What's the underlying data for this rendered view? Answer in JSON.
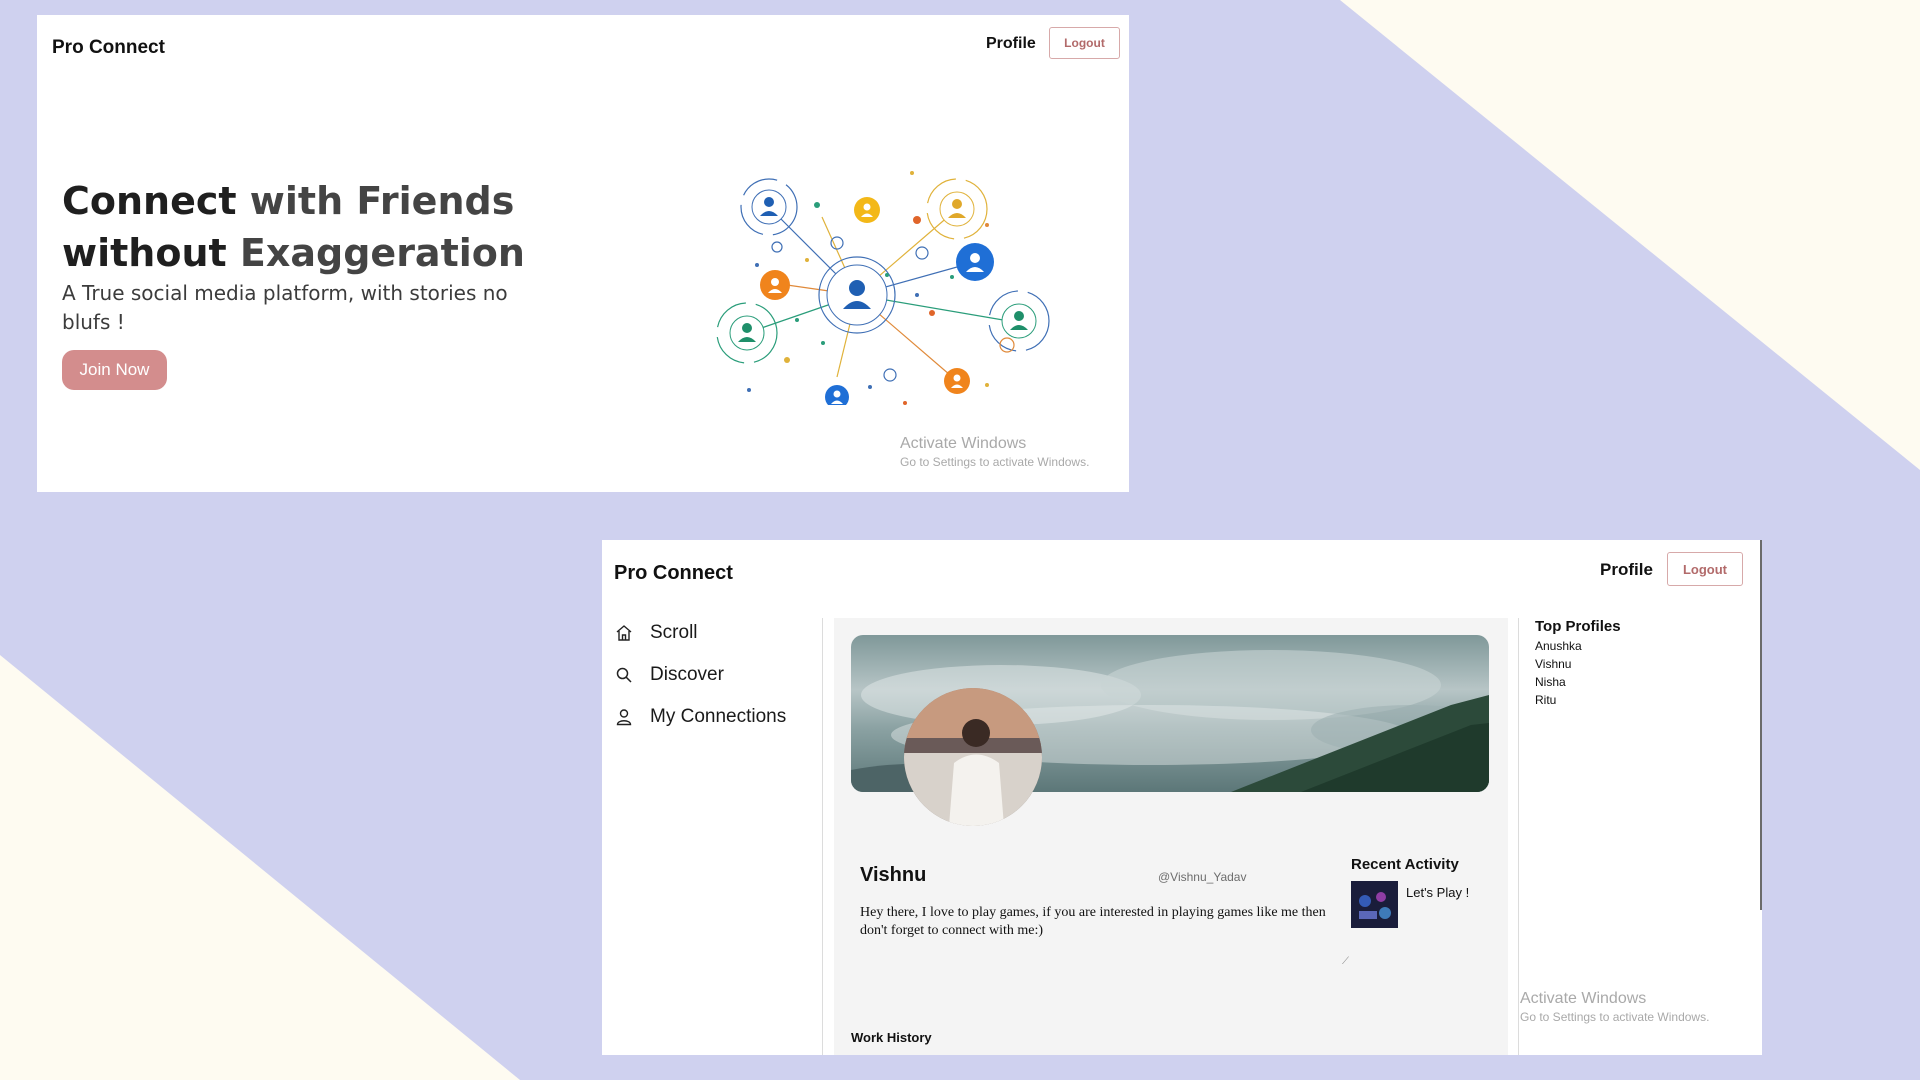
{
  "colors": {
    "page_background": "#cfd1ef",
    "corner_accent": "#fefbf1",
    "join_button": "#d38d8d",
    "logout_text": "#b26a6a"
  },
  "landing": {
    "brand": "Pro Connect",
    "nav": {
      "profile": "Profile",
      "logout": "Logout"
    },
    "hero": {
      "title_line1_dark": "Connect ",
      "title_line1_light": "with Friends",
      "title_line2_dark": "without ",
      "title_line2_light": "Exaggeration",
      "subtitle": "A True social media platform, with stories no blufs !",
      "cta": "Join Now"
    },
    "watermark": {
      "title": "Activate Windows",
      "subtitle": "Go to Settings to activate Windows."
    }
  },
  "profile_page": {
    "brand": "Pro Connect",
    "nav": {
      "profile": "Profile",
      "logout": "Logout"
    },
    "sidebar": [
      {
        "label": "Scroll",
        "icon": "home-icon"
      },
      {
        "label": "Discover",
        "icon": "search-icon"
      },
      {
        "label": "My Connections",
        "icon": "user-icon"
      }
    ],
    "profile": {
      "name": "Vishnu",
      "handle": "@Vishnu_Yadav",
      "bio": "Hey there, I love to play games, if you are interested in playing games like me then don't forget to connect with me:)",
      "work_history_title": "Work History"
    },
    "recent_activity": {
      "title": "Recent Activity",
      "post_text": "Let's Play !"
    },
    "top_profiles": {
      "title": "Top Profiles",
      "items": [
        "Anushka",
        "Vishnu",
        "Nisha",
        "Ritu"
      ]
    },
    "watermark": {
      "title": "Activate Windows",
      "subtitle": "Go to Settings to activate Windows."
    }
  }
}
